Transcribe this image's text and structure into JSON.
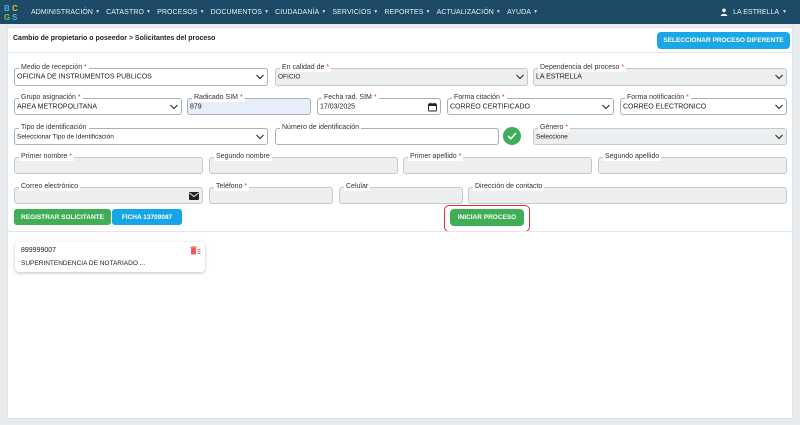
{
  "nav": {
    "logo_letters": "BCGS",
    "items": [
      "ADMINISTRACIÓN",
      "CATASTRO",
      "PROCESOS",
      "DOCUMENTOS",
      "CIUDADANÍA",
      "SERVICIOS",
      "REPORTES",
      "ACTUALIZACIÓN",
      "AYUDA"
    ],
    "user": "LA ESTRELLA"
  },
  "header": {
    "breadcrumb": "Cambio de propietario o poseedor > Solicitantes del proceso",
    "change_button": "SELECCIONAR PROCESO DIFERENTE"
  },
  "form": {
    "medio_recepcion": {
      "label": "Medio de recepción",
      "value": "OFICINA DE INSTRUMENTOS PUBLICOS"
    },
    "en_calidad": {
      "label": "En calidad de",
      "value": "OFICIO"
    },
    "dependencia": {
      "label": "Dependencia del proceso",
      "value": "LA ESTRELLA"
    },
    "grupo_asignacion": {
      "label": "Grupo asignación",
      "value": "AREA METROPOLITANA"
    },
    "radicado_sim": {
      "label": "Radicado SIM",
      "value": "879"
    },
    "fecha_rad": {
      "label": "Fecha rad. SIM",
      "value": "17/03/2025"
    },
    "forma_citacion": {
      "label": "Forma citación",
      "value": "CORREO CERTIFICADO"
    },
    "forma_notificacion": {
      "label": "Forma notificación",
      "value": "CORREO ELECTRONICO"
    },
    "tipo_identificacion": {
      "label": "Tipo de identificación",
      "value": "Seleccionar Tipo de Identificación"
    },
    "numero_identificacion": {
      "label": "Número de identificación",
      "value": ""
    },
    "genero": {
      "label": "Género",
      "value": "Seleccione"
    },
    "primer_nombre": {
      "label": "Primer nombre",
      "value": ""
    },
    "segundo_nombre": {
      "label": "Segundo nombre",
      "value": ""
    },
    "primer_apellido": {
      "label": "Primer apellido",
      "value": ""
    },
    "segundo_apellido": {
      "label": "Segundo apellido",
      "value": ""
    },
    "correo": {
      "label": "Correo electrónico",
      "value": ""
    },
    "telefono": {
      "label": "Teléfono",
      "value": ""
    },
    "celular": {
      "label": "Celular",
      "value": ""
    },
    "direccion": {
      "label": "Dirección de contacto",
      "value": ""
    },
    "required_mark": "*"
  },
  "actions": {
    "register": "REGISTRAR SOLICITANTE",
    "ficha": "FICHA 13709087",
    "start": "INICIAR PROCESO"
  },
  "applicants": [
    {
      "id": "899999007",
      "name": "SUPERINTENDENCIA DE NOTARIADO ..."
    }
  ],
  "colors": {
    "navbar": "#1d4a66",
    "primary_blue": "#1ba6e8",
    "success_green": "#3fae56",
    "highlight_red": "#d93131"
  }
}
